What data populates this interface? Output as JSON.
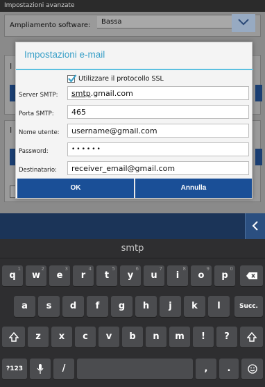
{
  "statusbar": {
    "title": "Impostazioni avanzate"
  },
  "background": {
    "row1_label": "Ampliamento software:",
    "row1_value": "Bassa",
    "side_letter_1": "I",
    "side_letter_2": "I"
  },
  "dialog": {
    "title": "Impostazioni e-mail",
    "ssl_label": "Utilizzare il protocollo SSL",
    "ssl_checked": true,
    "fields": [
      {
        "label": "Server SMTP:",
        "value_underlined": "smtp",
        "value_rest": ".gmail.com"
      },
      {
        "label": "Porta SMTP:",
        "value": "465"
      },
      {
        "label": "Nome utente:",
        "value": "username@gmail.com"
      },
      {
        "label": "Password:",
        "value": "••••••"
      },
      {
        "label": "Destinatario:",
        "value": "receiver_email@gmail.com"
      }
    ],
    "ok_label": "OK",
    "cancel_label": "Annulla"
  },
  "keyboard": {
    "suggestion": "smtp",
    "row1": [
      {
        "k": "q",
        "h": "1"
      },
      {
        "k": "w",
        "h": "2"
      },
      {
        "k": "e",
        "h": "3"
      },
      {
        "k": "r",
        "h": "4"
      },
      {
        "k": "t",
        "h": "5"
      },
      {
        "k": "y",
        "h": "6"
      },
      {
        "k": "u",
        "h": "7"
      },
      {
        "k": "i",
        "h": "8"
      },
      {
        "k": "o",
        "h": "9"
      },
      {
        "k": "p",
        "h": "0"
      }
    ],
    "row2": [
      "a",
      "s",
      "d",
      "f",
      "g",
      "h",
      "j",
      "k",
      "l"
    ],
    "enter_label": "Succ.",
    "row3": [
      "z",
      "x",
      "c",
      "v",
      "b",
      "n",
      "m",
      "!",
      "?"
    ],
    "symbols_label": "?123",
    "slash": "/",
    "comma": ",",
    "period": "."
  },
  "colors": {
    "dialog_title": "#3aa0c8",
    "button_blue": "#1a4f97"
  }
}
